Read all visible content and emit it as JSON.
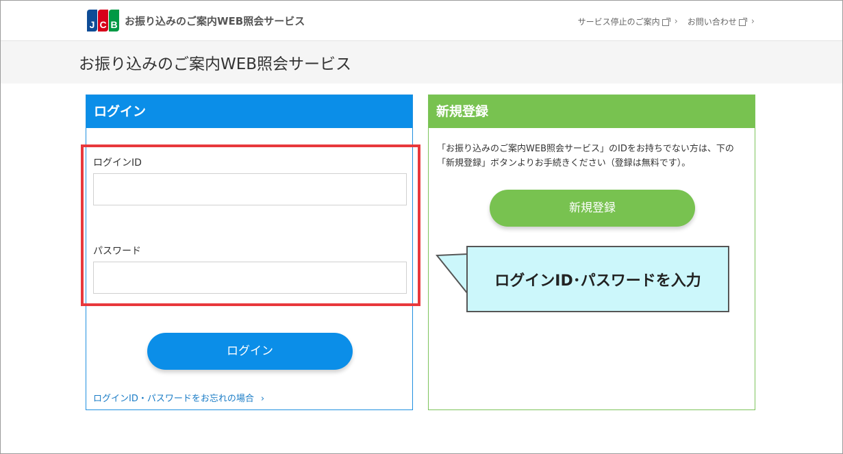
{
  "header": {
    "logo_letters": [
      "J",
      "C",
      "B"
    ],
    "logo_text": "お振り込みのご案内WEB照会サービス",
    "links": [
      {
        "label": "サービス停止のご案内"
      },
      {
        "label": "お問い合わせ"
      }
    ]
  },
  "page": {
    "title": "お振り込みのご案内WEB照会サービス"
  },
  "login": {
    "heading": "ログイン",
    "id_label": "ログインID",
    "id_value": "",
    "password_label": "パスワード",
    "password_value": "",
    "button_label": "ログイン",
    "forgot_link": "ログインID・パスワードをお忘れの場合"
  },
  "register": {
    "heading": "新規登録",
    "description": "「お振り込みのご案内WEB照会サービス」のIDをお持ちでない方は、下の「新規登録」ボタンよりお手続きください（登録は無料です）。",
    "button_label": "新規登録"
  },
  "annotation": {
    "callout_text": "ログインID･パスワードを入力"
  },
  "colors": {
    "login_blue": "#0b8ee8",
    "register_green": "#78c250",
    "highlight_red": "#e8383c",
    "callout_bg": "#ccf7fb"
  }
}
